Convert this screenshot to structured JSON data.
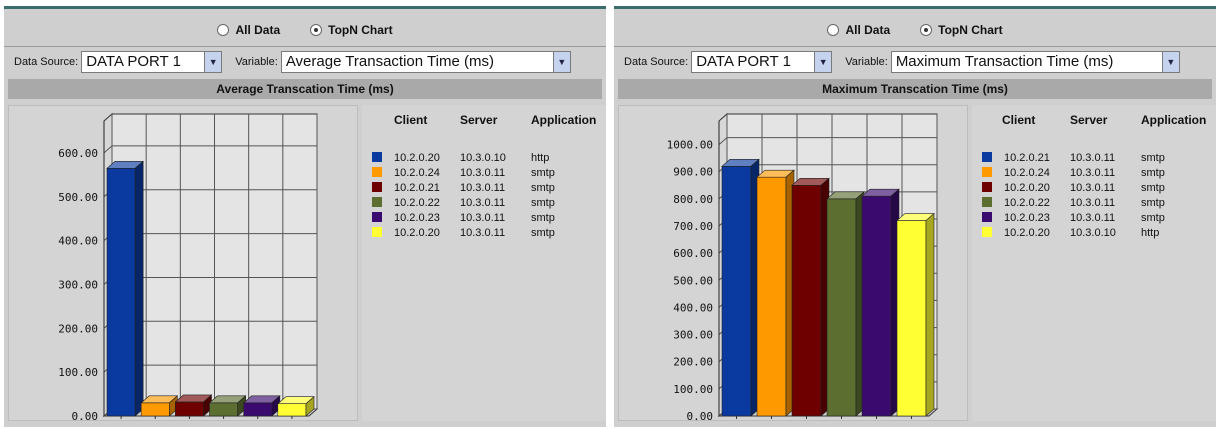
{
  "panels": [
    {
      "radio": {
        "all_label": "All Data",
        "topn_label": "TopN Chart",
        "selected": "topn"
      },
      "source_label": "Data Source:",
      "source_value": "DATA PORT 1",
      "variable_label": "Variable:",
      "variable_value": "Average Transaction Time (ms)",
      "legend_headers": {
        "client": "Client",
        "server": "Server",
        "application": "Application"
      },
      "legend_rows": [
        {
          "client": "10.2.0.20",
          "server": "10.3.0.10",
          "app": "http",
          "color": "#0a3aa0"
        },
        {
          "client": "10.2.0.24",
          "server": "10.3.0.11",
          "app": "smtp",
          "color": "#ff9900"
        },
        {
          "client": "10.2.0.21",
          "server": "10.3.0.11",
          "app": "smtp",
          "color": "#6e0000"
        },
        {
          "client": "10.2.0.22",
          "server": "10.3.0.11",
          "app": "smtp",
          "color": "#5c6e30"
        },
        {
          "client": "10.2.0.23",
          "server": "10.3.0.11",
          "app": "smtp",
          "color": "#3a0a6e"
        },
        {
          "client": "10.2.0.20",
          "server": "10.3.0.11",
          "app": "smtp",
          "color": "#ffff33"
        }
      ]
    },
    {
      "radio": {
        "all_label": "All Data",
        "topn_label": "TopN Chart",
        "selected": "topn"
      },
      "source_label": "Data Source:",
      "source_value": "DATA PORT 1",
      "variable_label": "Variable:",
      "variable_value": "Maximum Transaction Time (ms)",
      "legend_headers": {
        "client": "Client",
        "server": "Server",
        "application": "Application"
      },
      "legend_rows": [
        {
          "client": "10.2.0.21",
          "server": "10.3.0.11",
          "app": "smtp",
          "color": "#0a3aa0"
        },
        {
          "client": "10.2.0.24",
          "server": "10.3.0.11",
          "app": "smtp",
          "color": "#ff9900"
        },
        {
          "client": "10.2.0.20",
          "server": "10.3.0.11",
          "app": "smtp",
          "color": "#6e0000"
        },
        {
          "client": "10.2.0.22",
          "server": "10.3.0.11",
          "app": "smtp",
          "color": "#5c6e30"
        },
        {
          "client": "10.2.0.23",
          "server": "10.3.0.11",
          "app": "smtp",
          "color": "#3a0a6e"
        },
        {
          "client": "10.2.0.20",
          "server": "10.3.0.10",
          "app": "http",
          "color": "#ffff33"
        }
      ]
    }
  ],
  "chart_data": [
    {
      "type": "bar",
      "title": "Average Transcation Time (ms)",
      "ylim": [
        0,
        650
      ],
      "yticks": [
        0,
        100,
        200,
        300,
        400,
        500,
        600
      ],
      "ytick_labels": [
        "0.00",
        "100.00",
        "200.00",
        "300.00",
        "400.00",
        "500.00",
        "600.00"
      ],
      "categories": [
        "10.2.0.20 / 10.3.0.10 / http",
        "10.2.0.24 / 10.3.0.11 / smtp",
        "10.2.0.21 / 10.3.0.11 / smtp",
        "10.2.0.22 / 10.3.0.11 / smtp",
        "10.2.0.23 / 10.3.0.11 / smtp",
        "10.2.0.20 / 10.3.0.11 / smtp"
      ],
      "values": [
        565,
        30,
        32,
        30,
        30,
        28
      ],
      "colors": [
        "#0a3aa0",
        "#ff9900",
        "#6e0000",
        "#5c6e30",
        "#3a0a6e",
        "#ffff33"
      ],
      "grid": true
    },
    {
      "type": "bar",
      "title": "Maximum Transcation Time (ms)",
      "ylim": [
        0,
        1050
      ],
      "yticks": [
        0,
        100,
        200,
        300,
        400,
        500,
        600,
        700,
        800,
        900,
        1000
      ],
      "ytick_labels": [
        "0.00",
        "100.00",
        "200.00",
        "300.00",
        "400.00",
        "500.00",
        "600.00",
        "700.00",
        "800.00",
        "900.00",
        "1000.00"
      ],
      "categories": [
        "10.2.0.21 / 10.3.0.11 / smtp",
        "10.2.0.24 / 10.3.0.11 / smtp",
        "10.2.0.20 / 10.3.0.11 / smtp",
        "10.2.0.22 / 10.3.0.11 / smtp",
        "10.2.0.23 / 10.3.0.11 / smtp",
        "10.2.0.20 / 10.3.0.10 / http"
      ],
      "values": [
        920,
        880,
        850,
        800,
        810,
        720
      ],
      "colors": [
        "#0a3aa0",
        "#ff9900",
        "#6e0000",
        "#5c6e30",
        "#3a0a6e",
        "#ffff33"
      ],
      "grid": true
    }
  ]
}
